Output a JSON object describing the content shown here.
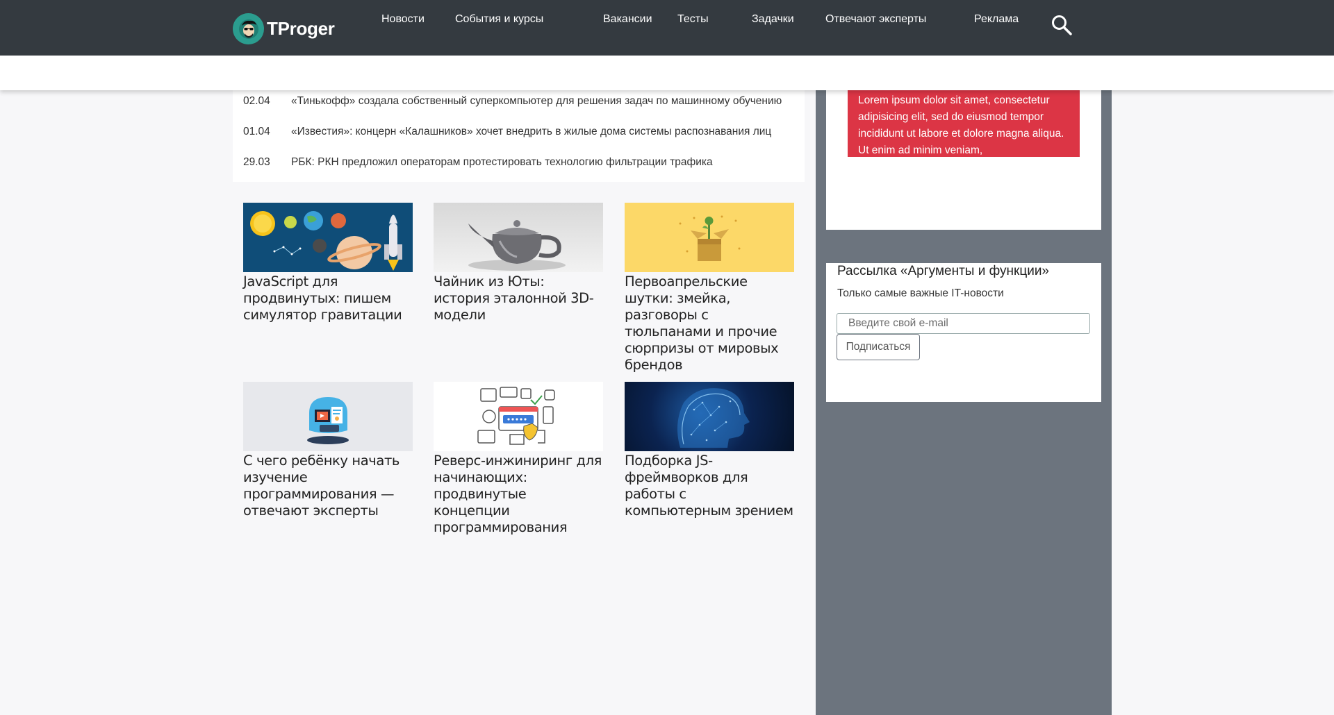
{
  "header": {
    "logo_text": "TProger",
    "nav": [
      {
        "label": "Новости"
      },
      {
        "label": "События и курсы"
      },
      {
        "label": "Вакансии"
      },
      {
        "label": "Тесты"
      },
      {
        "label": "Задачки"
      },
      {
        "label": "Отвечают эксперты"
      },
      {
        "label": "Реклама"
      }
    ],
    "search_icon": "search-icon"
  },
  "news": [
    {
      "date": "02.04",
      "title": "«Тинькофф» создала собственный суперкомпьютер для решения задач по машинному обучению"
    },
    {
      "date": "01.04",
      "title": "«Известия»: концерн «Калашников» хочет внедрить в жилые дома системы распознавания лиц"
    },
    {
      "date": "29.03",
      "title": "РБК: РКН предложил операторам протестировать технологию фильтрации трафика"
    }
  ],
  "cards": [
    {
      "title": "JavaScript для продвинутых: пишем симулятор гравитации",
      "image": "space-planets-rocket-illustration"
    },
    {
      "title": "Чайник из Юты: история эталонной 3D-модели",
      "image": "utah-teapot-render"
    },
    {
      "title": "Первоапрельские шутки: змейка, разговоры с тюльпанами и прочие сюрпризы от мировых брендов",
      "image": "gift-box-with-tulip-illustration"
    },
    {
      "title": "С чего ребёнку начать изучение программирования — отвечают эксперты",
      "image": "child-learning-computer-illustration"
    },
    {
      "title": "Реверс-инжиниринг для начинающих: продвинутые концепции программирования",
      "image": "security-icons-illustration"
    },
    {
      "title": "Подборка JS-фреймворков для работы с компьютерным зрением",
      "image": "digital-head-profile"
    }
  ],
  "sidebar": {
    "ad_text": "Lorem ipsum dolor sit amet, consectetur adipisicing elit, sed do eiusmod tempor incididunt ut labore et dolore magna aliqua. Ut enim ad minim veniam,",
    "newsletter": {
      "title": "Рассылка «Аргументы и функции»",
      "description": "Только самые важные IT-новости",
      "email_placeholder": "Введите свой e-mail",
      "submit_label": "Подписаться"
    }
  },
  "colors": {
    "topbar": "#343a40",
    "accent_red": "#dc3545",
    "sidebar_gray": "#6c747e",
    "logo_teal": "#2b9d8f"
  }
}
